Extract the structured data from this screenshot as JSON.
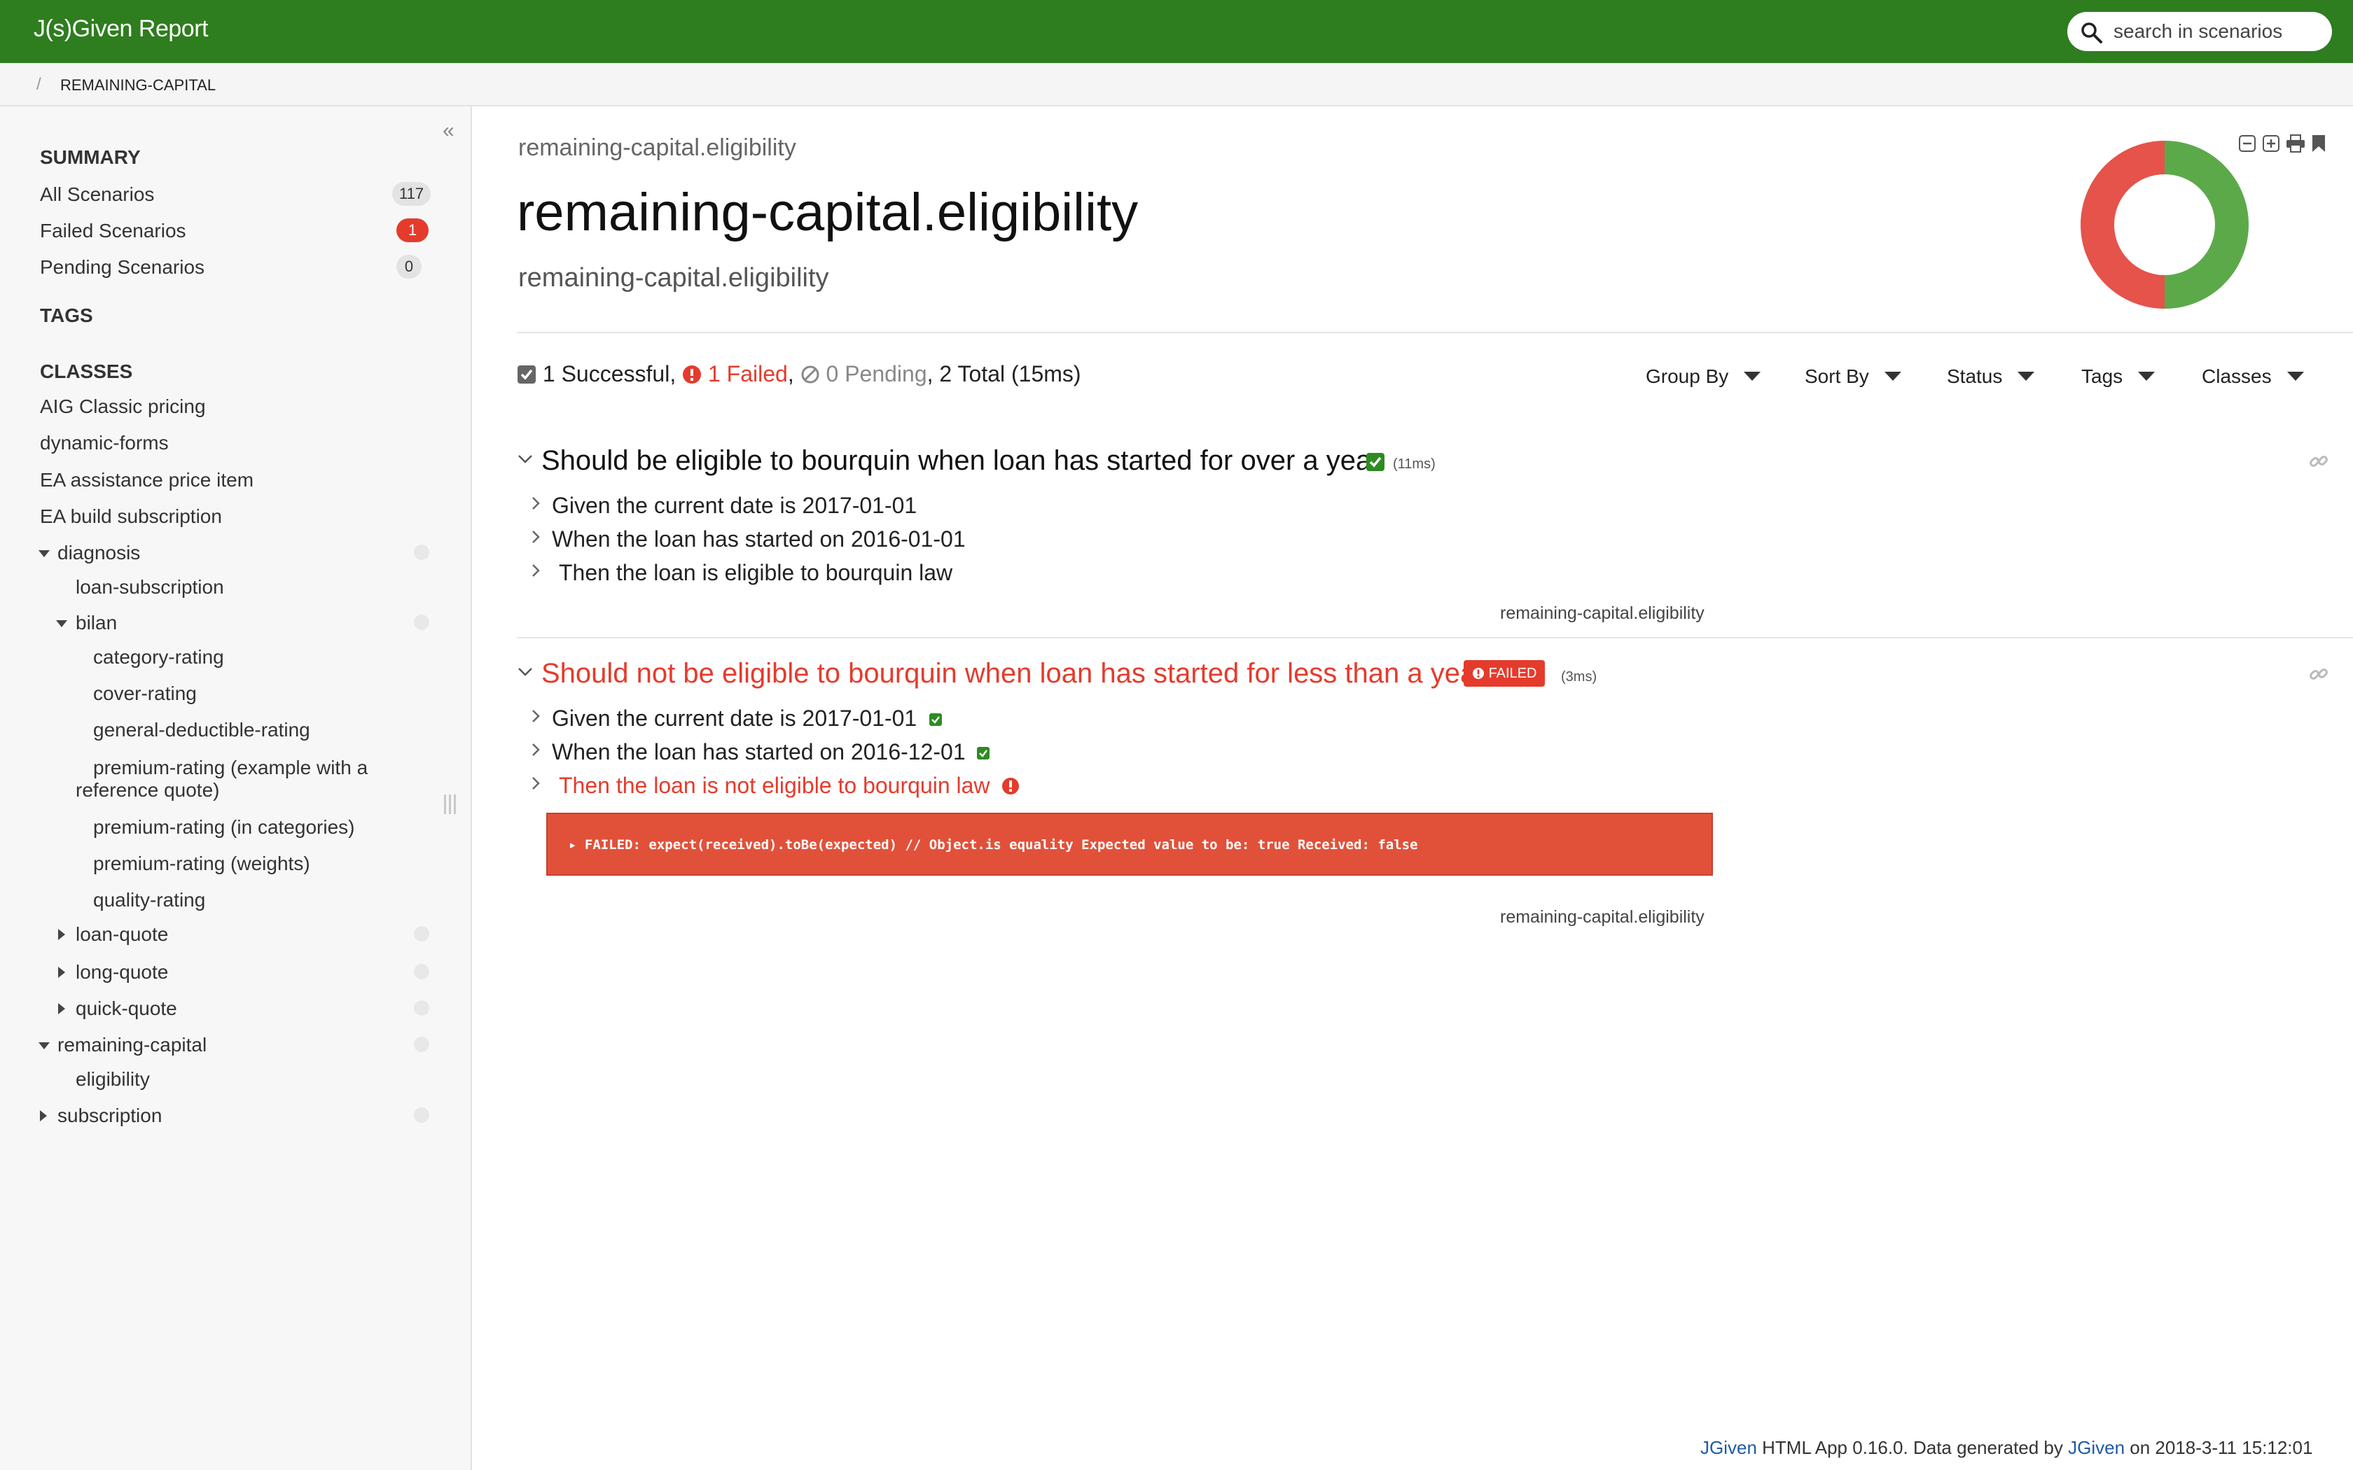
{
  "app": {
    "title": "J(s)Given Report"
  },
  "search": {
    "placeholder": "search in scenarios"
  },
  "breadcrumb": {
    "separator": "/",
    "current": "REMAINING-CAPITAL"
  },
  "sidebar": {
    "summary_heading": "SUMMARY",
    "summary_items": [
      {
        "label": "All Scenarios",
        "count": "117"
      },
      {
        "label": "Failed Scenarios",
        "count": "1"
      },
      {
        "label": "Pending Scenarios",
        "count": "0"
      }
    ],
    "tags_heading": "TAGS",
    "classes_heading": "CLASSES",
    "classes": {
      "aig": "AIG Classic pricing",
      "dynamic_forms": "dynamic-forms",
      "ea_assistance": "EA assistance price item",
      "ea_build": "EA build subscription",
      "diagnosis": "diagnosis",
      "loan_subscription": "loan-subscription",
      "bilan": "bilan",
      "category_rating": "category-rating",
      "cover_rating": "cover-rating",
      "general_deductible": "general-deductible-rating",
      "premium_ref_line1": "premium-rating (example with a",
      "premium_ref_line2": "reference quote)",
      "premium_categories": "premium-rating (in categories)",
      "premium_weights": "premium-rating (weights)",
      "quality_rating": "quality-rating",
      "loan_quote": "loan-quote",
      "long_quote": "long-quote",
      "quick_quote": "quick-quote",
      "remaining_capital": "remaining-capital",
      "eligibility": "eligibility",
      "subscription": "subscription"
    }
  },
  "main": {
    "subtitle": "remaining-capital.eligibility",
    "title": "remaining-capital.eligibility",
    "description": "remaining-capital.eligibility",
    "summary": {
      "successful": "1 Successful",
      "failed": "1 Failed",
      "pending": "0 Pending",
      "total": "2 Total (15ms)"
    },
    "dropdowns": [
      "Group By",
      "Sort By",
      "Status",
      "Tags",
      "Classes"
    ],
    "chart": {
      "successful": 1,
      "failed": 1,
      "pending": 0,
      "success_color": "#5ca94a",
      "failed_color": "#e5534b"
    }
  },
  "scenarios": [
    {
      "title": "Should be eligible to bourquin when loan has started for over a year",
      "duration": "(11ms)",
      "steps": [
        {
          "keyword": "Given",
          "text": "the current date is 2017-01-01"
        },
        {
          "keyword": "When",
          "text": "the loan has started on 2016-01-01"
        },
        {
          "keyword": "Then",
          "text": "the loan is eligible to bourquin law"
        }
      ],
      "tag": "remaining-capital.eligibility"
    },
    {
      "title": "Should not be eligible to bourquin when loan has started for less than a year",
      "status": "FAILED",
      "duration": "(3ms)",
      "steps": [
        {
          "keyword": "Given",
          "text": "the current date is 2017-01-01"
        },
        {
          "keyword": "When",
          "text": "the loan has started on 2016-12-01"
        },
        {
          "keyword": "Then",
          "text": "the loan is not eligible to bourquin law"
        }
      ],
      "error": "FAILED: expect(received).toBe(expected) // Object.is equality Expected value to be: true Received: false",
      "tag": "remaining-capital.eligibility"
    }
  ],
  "footer": {
    "link1": "JGiven",
    "text1": " HTML App 0.16.0. Data generated by ",
    "link2": "JGiven",
    "text2": " on 2018-3-11 15:12:01"
  }
}
